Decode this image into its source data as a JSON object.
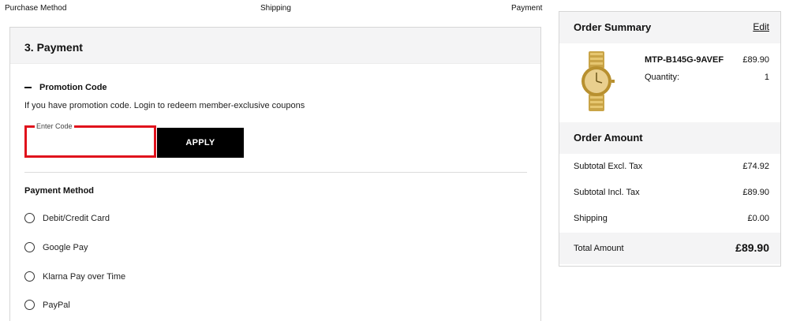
{
  "steps": {
    "purchase_method": "Purchase Method",
    "shipping": "Shipping",
    "payment": "Payment"
  },
  "payment": {
    "title": "3. Payment",
    "promo": {
      "label": "Promotion Code",
      "note": "If you have promotion code. Login to redeem member-exclusive coupons",
      "input_label": "Enter Code",
      "input_value": "",
      "apply_label": "APPLY"
    },
    "method": {
      "title": "Payment Method",
      "options": [
        {
          "label": "Debit/Credit Card"
        },
        {
          "label": "Google Pay"
        },
        {
          "label": "Klarna Pay over Time"
        },
        {
          "label": "PayPal"
        }
      ]
    }
  },
  "summary": {
    "title": "Order Summary",
    "edit_label": "Edit",
    "product": {
      "name": "MTP-B145G-9AVEF",
      "price": "£89.90",
      "quantity_label": "Quantity:",
      "quantity": "1",
      "image_icon": "gold-watch-icon"
    },
    "amount": {
      "title": "Order Amount",
      "rows": [
        {
          "label": "Subtotal Excl. Tax",
          "value": "£74.92"
        },
        {
          "label": "Subtotal Incl. Tax",
          "value": "£89.90"
        },
        {
          "label": "Shipping",
          "value": "£0.00"
        }
      ],
      "total_label": "Total Amount",
      "total_value": "£89.90"
    }
  },
  "colors": {
    "accent_highlight": "#e0121c",
    "button_bg": "#000000",
    "panel_header_bg": "#f4f4f5"
  }
}
